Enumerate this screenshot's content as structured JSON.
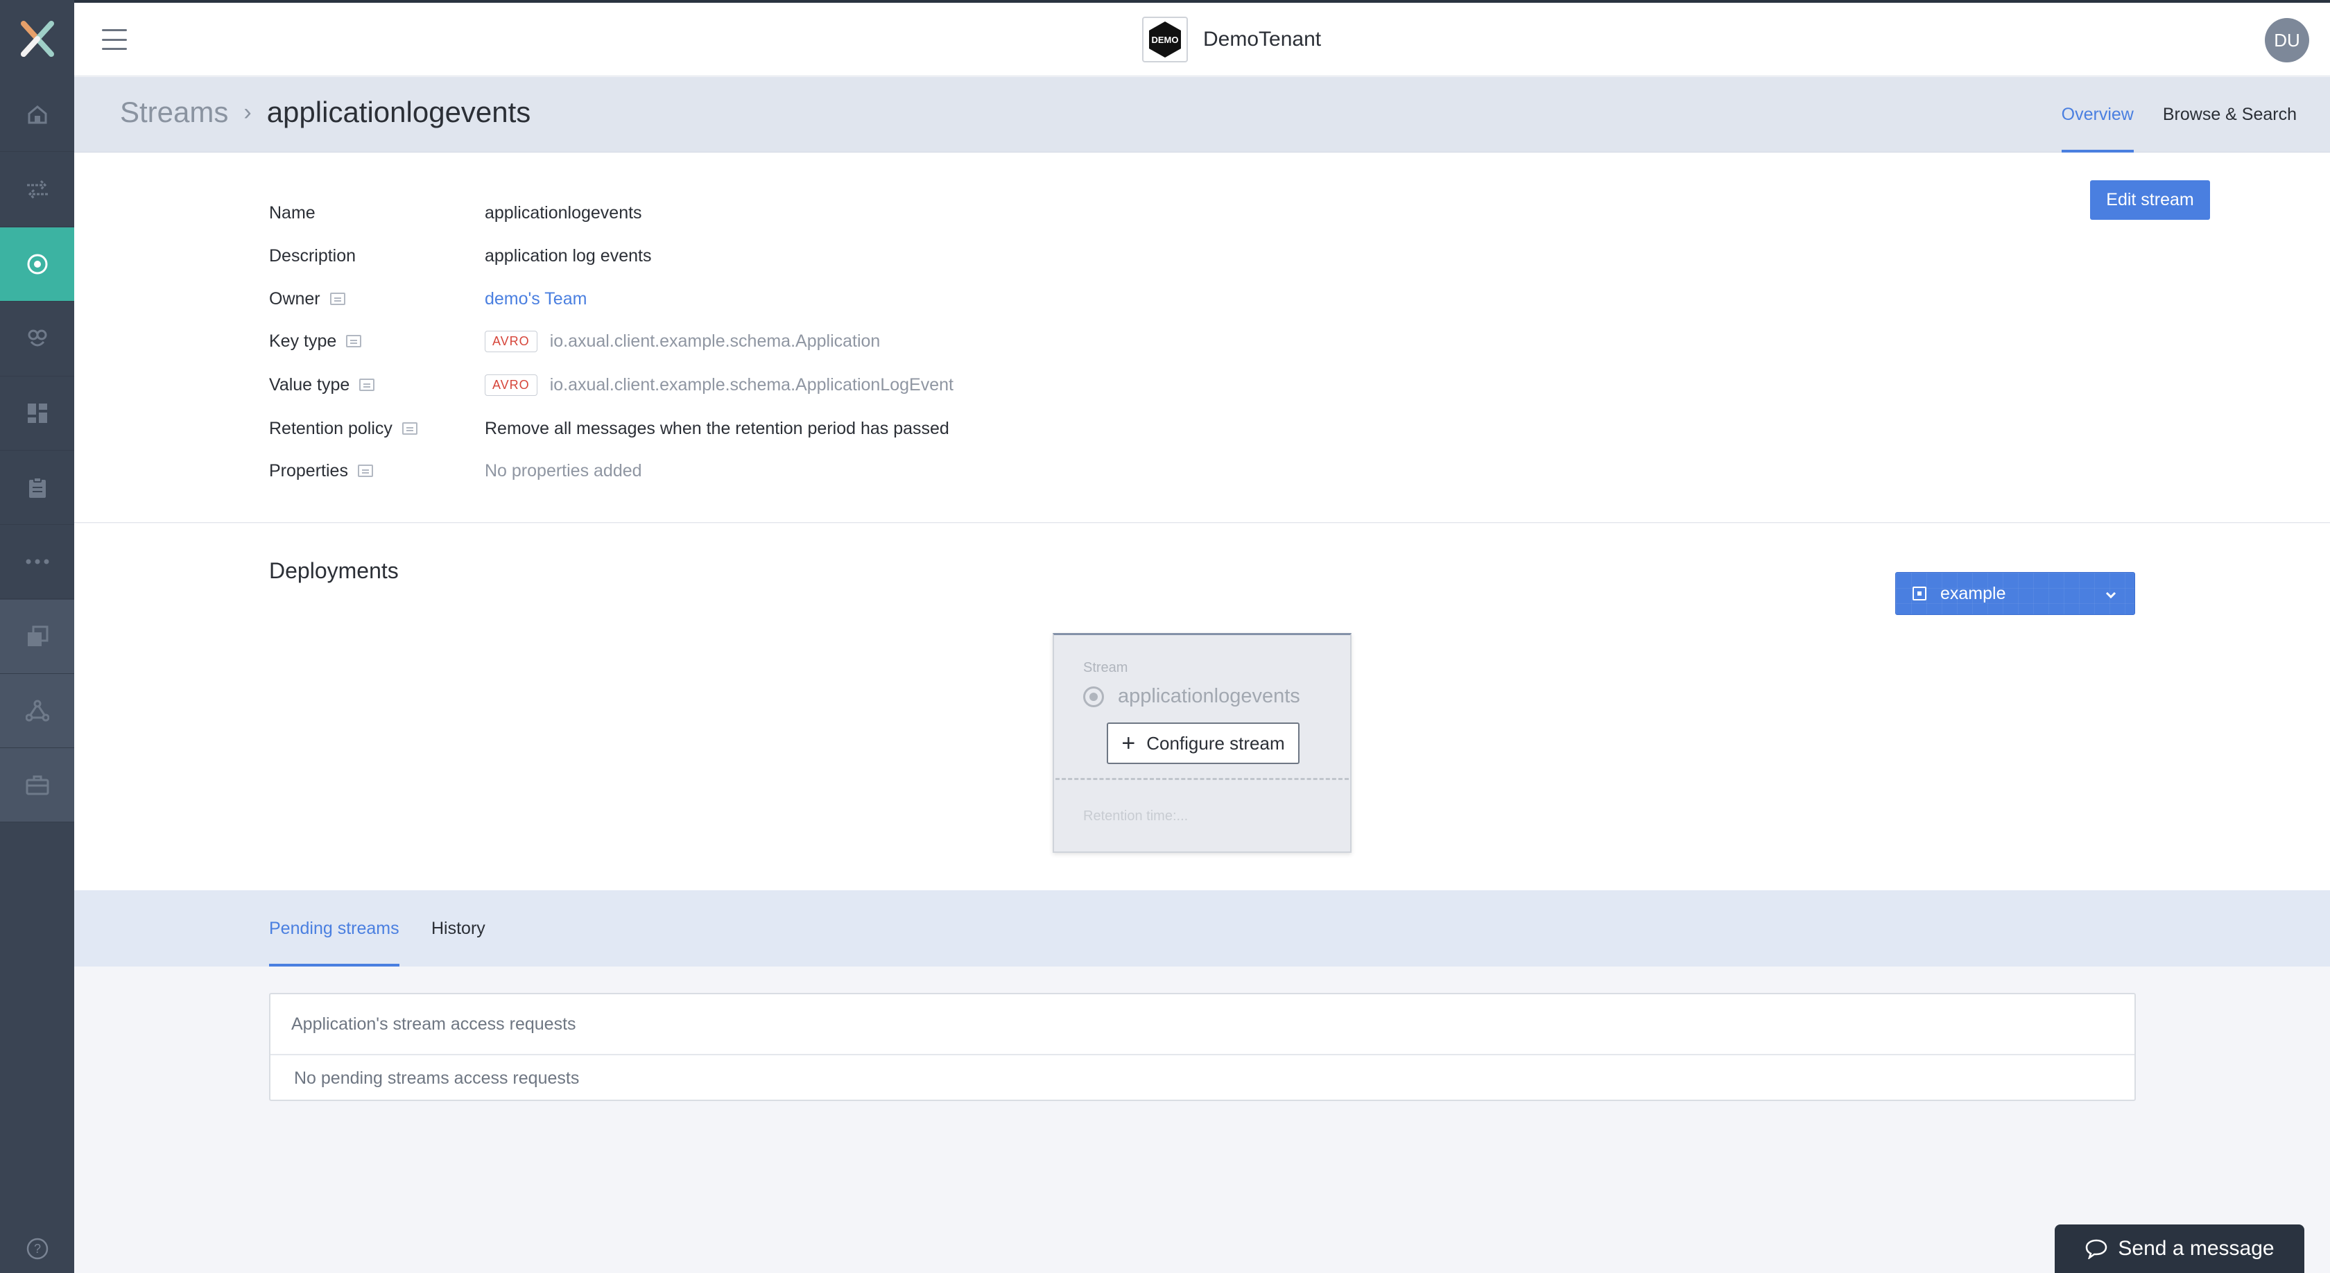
{
  "header": {
    "tenant_name": "DemoTenant",
    "tenant_logo_text": "DEMO",
    "avatar_initials": "DU"
  },
  "breadcrumb": {
    "parent": "Streams",
    "separator": "›",
    "current": "applicationlogevents"
  },
  "top_tabs": [
    {
      "label": "Overview",
      "active": true
    },
    {
      "label": "Browse & Search",
      "active": false
    }
  ],
  "details": {
    "edit_button": "Edit stream",
    "fields": {
      "name": {
        "label": "Name",
        "value": "applicationlogevents"
      },
      "description": {
        "label": "Description",
        "value": "application log events"
      },
      "owner": {
        "label": "Owner",
        "value": "demo's Team"
      },
      "key_type": {
        "label": "Key type",
        "badge": "AVRO",
        "value": "io.axual.client.example.schema.Application"
      },
      "value_type": {
        "label": "Value type",
        "badge": "AVRO",
        "value": "io.axual.client.example.schema.ApplicationLogEvent"
      },
      "retention_policy": {
        "label": "Retention policy",
        "value": "Remove all messages when the retention period has passed"
      },
      "properties": {
        "label": "Properties",
        "value": "No properties added"
      }
    }
  },
  "deployments": {
    "title": "Deployments",
    "environment": "example",
    "card": {
      "kicker": "Stream",
      "name": "applicationlogevents",
      "configure_button": "Configure stream",
      "retention": "Retention time:..."
    }
  },
  "bottom_tabs": [
    {
      "label": "Pending streams",
      "active": true
    },
    {
      "label": "History",
      "active": false
    }
  ],
  "requests": {
    "header": "Application's stream access requests",
    "empty": "No pending streams access requests"
  },
  "chat": {
    "label": "Send a message"
  },
  "colors": {
    "accent": "#4a7fe0",
    "sidebar": "#3a4453",
    "sidebar_active": "#3cb3a2"
  }
}
